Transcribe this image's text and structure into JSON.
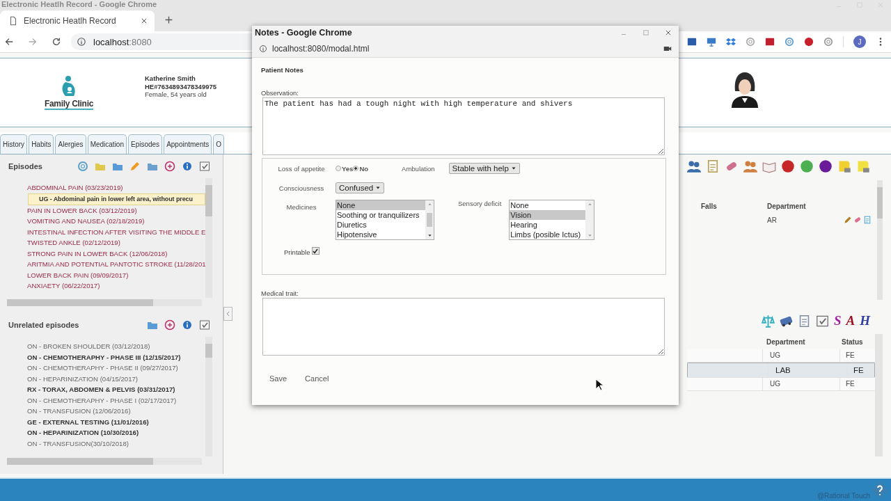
{
  "window": {
    "title": "Electronic Heatlh Record - Google Chrome"
  },
  "browser": {
    "tab_title": "Electronic Heatlh Record",
    "url_host": "localhost",
    "url_port": ":8080",
    "profile": "J"
  },
  "logo": {
    "text": "Family Clinic"
  },
  "patient": {
    "name": "Katherine Smith",
    "record": "HE#7634893478349975",
    "details": "Female, 54 years old"
  },
  "tabs": [
    {
      "label": "History",
      "selected": false
    },
    {
      "label": "Habits",
      "selected": false
    },
    {
      "label": "Alergies",
      "selected": false
    },
    {
      "label": "Medication",
      "selected": false
    },
    {
      "label": "Episodes",
      "selected": false
    },
    {
      "label": "Appointments",
      "selected": false
    },
    {
      "label": "O",
      "selected": false
    }
  ],
  "episodes": {
    "title": "Episodes",
    "items": [
      {
        "label": "ABDOMINAL PAIN (03/23/2019)",
        "children": [
          {
            "label": "UG - Abdominal pain in lower left area, without precu"
          }
        ]
      },
      {
        "label": "PAIN IN LOWER BACK (03/12/2019)"
      },
      {
        "label": "VOMITING AND NAUSEA (02/18/2019)"
      },
      {
        "label": "INTESTINAL INFECTION AFTER VISITING THE MIDDLE E"
      },
      {
        "label": "TWISTED ANKLE (02/12/2019)"
      },
      {
        "label": "STRONG PAIN IN LOWER BACK (12/06/2018)"
      },
      {
        "label": "ARITMIA AND POTENTIAL PANTOTIC STROKE (11/28/201"
      },
      {
        "label": "LOWER BACK PAIN (09/09/2017)"
      },
      {
        "label": "ANXIAETY (06/22/2017)"
      }
    ]
  },
  "unrelated": {
    "title": "Unrelated episodes",
    "items": [
      {
        "label": "ON - BROKEN SHOULDER (03/12/2018)",
        "bold": false
      },
      {
        "label": "ON - CHEMOTHERAPHY - PHASE III (12/15/2017)",
        "bold": true
      },
      {
        "label": "ON - CHEMOTHERAPHY - PHASE II (09/27/2017)",
        "bold": false
      },
      {
        "label": "ON - HEPARINIZATION (04/15/2017)",
        "bold": false
      },
      {
        "label": "RX - TORAX, ABDOMEN & PELVIS (03/31/2017)",
        "bold": true
      },
      {
        "label": "ON - CHEMOTHERAPHY - PHASE I (02/17/2017)",
        "bold": false
      },
      {
        "label": "ON - TRANSFUSION (12/06/2016)",
        "bold": false
      },
      {
        "label": "GE - EXTERNAL TESTING (11/01/2016)",
        "bold": true
      },
      {
        "label": "ON - HEPARINIZATION (10/30/2016)",
        "bold": true
      },
      {
        "label": "ON - TRANSFUSION(30/10/2018)",
        "bold": false
      }
    ]
  },
  "upper_table": {
    "columns": [
      "Falls",
      "Department"
    ],
    "rows": [
      {
        "department": "AR"
      }
    ]
  },
  "letter_icons": [
    "S",
    "A",
    "H"
  ],
  "lower_table": {
    "columns": [
      "Department",
      "Status"
    ],
    "rows": [
      {
        "department": "UG",
        "status": "FE",
        "selected": false
      },
      {
        "department": "LAB",
        "status": "FE",
        "selected": true
      },
      {
        "department": "UG",
        "status": "FE",
        "selected": false
      }
    ]
  },
  "footer": {
    "credit": "@Rational Touch"
  },
  "modal": {
    "window_title": "Notes - Google Chrome",
    "url": "localhost:8080/modal.html",
    "heading": "Patient Notes",
    "observation": {
      "label": "Observation:",
      "value": "The patient has had a tough night with high temperature and shivers"
    },
    "loss_of_appetite": {
      "label": "Loss of appetite",
      "options": [
        {
          "label": "Yes",
          "selected": false
        },
        {
          "label": "No",
          "selected": true
        }
      ]
    },
    "ambulation": {
      "label": "Ambulation",
      "value": "Stable with help"
    },
    "consciousness": {
      "label": "Consciousness",
      "value": "Confused"
    },
    "medicines": {
      "label": "Medicines",
      "options": [
        {
          "label": "None",
          "selected": true
        },
        {
          "label": "Soothing or tranquilizers",
          "selected": false
        },
        {
          "label": "Diuretics",
          "selected": false
        },
        {
          "label": "Hipotensive",
          "selected": false
        }
      ]
    },
    "sensory_deficit": {
      "label": "Sensory deficit",
      "options": [
        {
          "label": "None",
          "selected": false
        },
        {
          "label": "Vision",
          "selected": true
        },
        {
          "label": "Hearing",
          "selected": false
        },
        {
          "label": "Limbs (posible Ictus)",
          "selected": false
        }
      ]
    },
    "printable": {
      "label": "Printable",
      "checked": true
    },
    "medical_trait": {
      "label": "Medical trait:"
    },
    "buttons": [
      "Save",
      "Cancel"
    ]
  }
}
